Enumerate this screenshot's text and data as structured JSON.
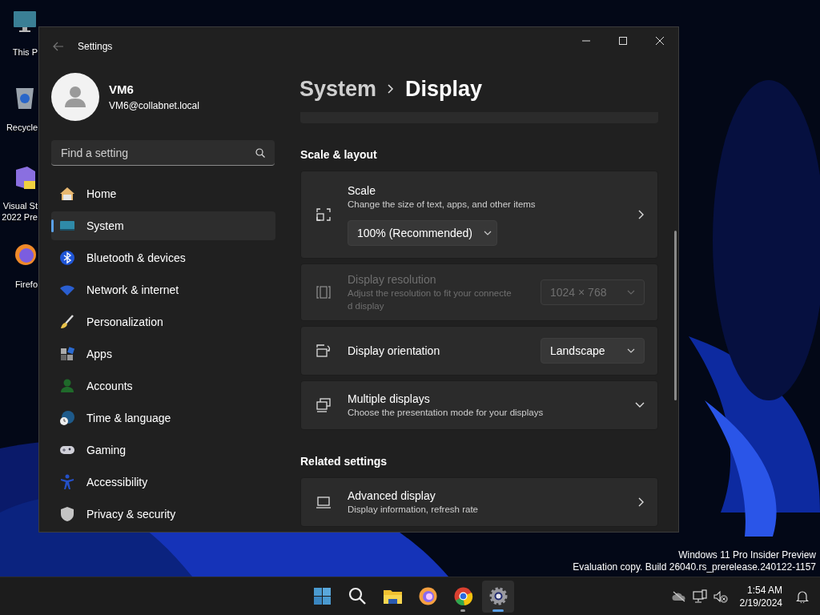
{
  "desktop_icons": [
    {
      "lines": [
        "This P"
      ]
    },
    {
      "lines": [
        "Recycle"
      ]
    },
    {
      "lines": [
        "Visual St",
        "2022 Pre"
      ]
    },
    {
      "lines": [
        "Firefo"
      ]
    }
  ],
  "window": {
    "title": "Settings"
  },
  "user": {
    "name": "VM6",
    "email": "VM6@collabnet.local"
  },
  "search": {
    "placeholder": "Find a setting"
  },
  "nav": [
    {
      "label": "Home",
      "selected": false
    },
    {
      "label": "System",
      "selected": true
    },
    {
      "label": "Bluetooth & devices",
      "selected": false
    },
    {
      "label": "Network & internet",
      "selected": false
    },
    {
      "label": "Personalization",
      "selected": false
    },
    {
      "label": "Apps",
      "selected": false
    },
    {
      "label": "Accounts",
      "selected": false
    },
    {
      "label": "Time & language",
      "selected": false
    },
    {
      "label": "Gaming",
      "selected": false
    },
    {
      "label": "Accessibility",
      "selected": false
    },
    {
      "label": "Privacy & security",
      "selected": false
    }
  ],
  "breadcrumb": [
    "System",
    "Display"
  ],
  "sections": [
    {
      "heading": "Scale & layout",
      "rows": [
        {
          "kind": "link_dropdown",
          "title": "Scale",
          "description": "Change the size of text, apps, and other items",
          "value": "100% (Recommended)",
          "disabled": false
        },
        {
          "kind": "dropdown",
          "title": "Display resolution",
          "description": "Adjust the resolution to fit your connecte\nd display",
          "value": "1024 × 768",
          "disabled": true
        },
        {
          "kind": "dropdown",
          "title": "Display orientation",
          "value": "Landscape",
          "disabled": false
        },
        {
          "kind": "expander",
          "title": "Multiple displays",
          "description": "Choose the presentation mode for your displays",
          "disabled": false,
          "expanded": false
        }
      ]
    },
    {
      "heading": "Related settings",
      "rows": [
        {
          "kind": "link",
          "title": "Advanced display",
          "description": "Display information, refresh rate",
          "disabled": false
        }
      ]
    }
  ],
  "desktop_notice": [
    "Windows 11 Pro Insider Preview",
    "Evaluation copy. Build 26040.rs_prerelease.240122-1157"
  ],
  "taskbar": {
    "apps": [
      {
        "running": false,
        "active": false
      },
      {
        "running": false,
        "active": false
      },
      {
        "running": false,
        "active": false
      },
      {
        "running": false,
        "active": false
      },
      {
        "running": true,
        "active": false
      },
      {
        "running": true,
        "active": true
      }
    ],
    "time": "1:54 AM",
    "date": "2/19/2024"
  }
}
